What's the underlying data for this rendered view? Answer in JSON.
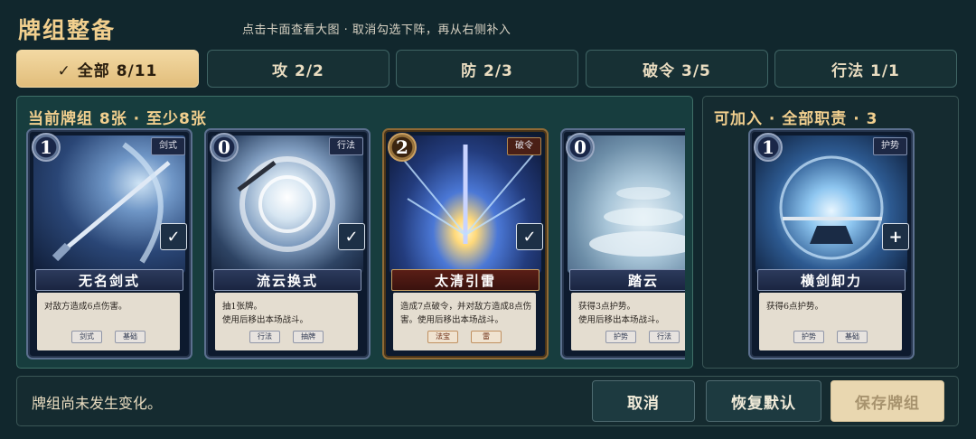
{
  "header": {
    "title": "牌组整备",
    "hint": "点击卡面查看大图 · 取消勾选下阵，再从右侧补入"
  },
  "tabs": [
    {
      "label": "✓ 全部 8/11",
      "active": true
    },
    {
      "label": "攻 2/2",
      "active": false
    },
    {
      "label": "防 2/3",
      "active": false
    },
    {
      "label": "破令 3/5",
      "active": false
    },
    {
      "label": "行法 1/1",
      "active": false
    }
  ],
  "deck": {
    "title": "当前牌组 8张 · 至少8张",
    "cards": [
      {
        "cost": "1",
        "type": "剑式",
        "name": "无名剑式",
        "desc": "对敌方造成6点伤害。",
        "tags": [
          "剑式",
          "基础"
        ],
        "selected_mark": "✓",
        "art": "sword"
      },
      {
        "cost": "0",
        "type": "行法",
        "name": "流云换式",
        "desc": "抽1张牌。\n使用后移出本场战斗。",
        "tags": [
          "行法",
          "抽牌"
        ],
        "selected_mark": "✓",
        "art": "cloud"
      },
      {
        "cost": "2",
        "type": "破令",
        "name": "太清引雷",
        "desc": "造成7点破令，并对敌方造成8点伤害。使用后移出本场战斗。",
        "tags": [
          "法宝",
          "雷"
        ],
        "selected_mark": "✓",
        "art": "thunder"
      },
      {
        "cost": "0",
        "type": "",
        "name": "踏云",
        "desc": "获得3点护势。\n使用后移出本场战斗。",
        "tags": [
          "护势",
          "行法"
        ],
        "selected_mark": "",
        "art": "step"
      }
    ]
  },
  "available": {
    "title": "可加入 · 全部职责 · 3",
    "cards": [
      {
        "cost": "1",
        "type": "护势",
        "name": "横剑卸力",
        "desc": "获得6点护势。",
        "tags": [
          "护势",
          "基础"
        ],
        "add_mark": "+",
        "art": "guard"
      }
    ]
  },
  "footer": {
    "status": "牌组尚未发生变化。",
    "cancel_label": "取消",
    "restore_label": "恢复默认",
    "save_label": "保存牌组"
  },
  "colors": {
    "background": "#11272d",
    "accent_gold": "#f1cf8e",
    "active_tab": "#e1bd7b",
    "deck_panel": "#173d3e"
  }
}
